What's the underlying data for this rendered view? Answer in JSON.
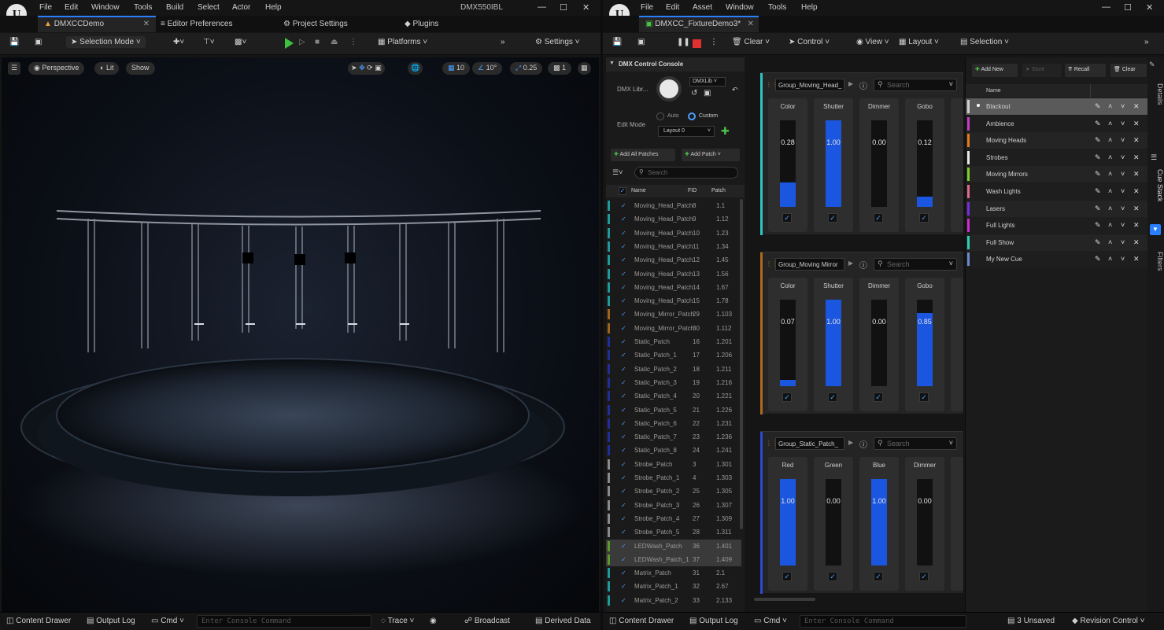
{
  "left": {
    "menu": [
      "File",
      "Edit",
      "Window",
      "Tools",
      "Build",
      "Select",
      "Actor",
      "Help"
    ],
    "title": "DMX550IBL",
    "tabs": {
      "project": "DMXCCDemo",
      "editor_prefs": "Editor Preferences",
      "project_settings": "Project Settings",
      "plugins": "Plugins"
    },
    "toolbar": {
      "selection_mode": "Selection Mode",
      "platforms": "Platforms",
      "settings": "Settings"
    },
    "viewport": {
      "perspective": "Perspective",
      "lit": "Lit",
      "show": "Show",
      "grid": "10",
      "angle": "10°",
      "scale": "0.25",
      "cam": "1"
    },
    "status": {
      "content_drawer": "Content Drawer",
      "output_log": "Output Log",
      "cmd": "Cmd",
      "console_placeholder": "Enter Console Command",
      "trace": "Trace",
      "broadcast": "Broadcast",
      "derived_data": "Derived Data"
    }
  },
  "right": {
    "menu": [
      "File",
      "Edit",
      "Asset",
      "Window",
      "Tools",
      "Help"
    ],
    "tab": "DMXCC_FixtureDemo3*",
    "toolbar": {
      "clear": "Clear",
      "control": "Control",
      "view": "View",
      "layout": "Layout",
      "selection": "Selection"
    },
    "console": {
      "title": "DMX Control Console",
      "dmx_lib_label": "DMX Libr...",
      "dmx_lib_value": "DMXLib",
      "auto": "Auto",
      "custom": "Custom",
      "edit_mode": "Edit Mode",
      "layout": "Layout 0",
      "add_all": "Add All Patches",
      "add_patch": "Add Patch",
      "search": "Search",
      "cols": {
        "name": "Name",
        "fid": "FID",
        "patch": "Patch"
      },
      "patches": [
        {
          "name": "Moving_Head_Patch",
          "fid": "8",
          "patch": "1.1",
          "color": "#1f9a9a"
        },
        {
          "name": "Moving_Head_Patch",
          "fid": "9",
          "patch": "1.12",
          "color": "#1f9a9a"
        },
        {
          "name": "Moving_Head_Patch",
          "fid": "10",
          "patch": "1.23",
          "color": "#1f9a9a"
        },
        {
          "name": "Moving_Head_Patch",
          "fid": "11",
          "patch": "1.34",
          "color": "#1f9a9a"
        },
        {
          "name": "Moving_Head_Patch",
          "fid": "12",
          "patch": "1.45",
          "color": "#1f9a9a"
        },
        {
          "name": "Moving_Head_Patch",
          "fid": "13",
          "patch": "1.56",
          "color": "#1f9a9a"
        },
        {
          "name": "Moving_Head_Patch",
          "fid": "14",
          "patch": "1.67",
          "color": "#1f9a9a"
        },
        {
          "name": "Moving_Head_Patch",
          "fid": "15",
          "patch": "1.78",
          "color": "#1f9a9a"
        },
        {
          "name": "Moving_Mirror_Patch",
          "fid": "29",
          "patch": "1.103",
          "color": "#a0651a"
        },
        {
          "name": "Moving_Mirror_Patch",
          "fid": "30",
          "patch": "1.112",
          "color": "#a0651a"
        },
        {
          "name": "Static_Patch",
          "fid": "16",
          "patch": "1.201",
          "color": "#1e2f9a"
        },
        {
          "name": "Static_Patch_1",
          "fid": "17",
          "patch": "1.206",
          "color": "#1e2f9a"
        },
        {
          "name": "Static_Patch_2",
          "fid": "18",
          "patch": "1.211",
          "color": "#1e2f9a"
        },
        {
          "name": "Static_Patch_3",
          "fid": "19",
          "patch": "1.216",
          "color": "#1e2f9a"
        },
        {
          "name": "Static_Patch_4",
          "fid": "20",
          "patch": "1.221",
          "color": "#1e2f9a"
        },
        {
          "name": "Static_Patch_5",
          "fid": "21",
          "patch": "1.226",
          "color": "#1e2f9a"
        },
        {
          "name": "Static_Patch_6",
          "fid": "22",
          "patch": "1.231",
          "color": "#1e2f9a"
        },
        {
          "name": "Static_Patch_7",
          "fid": "23",
          "patch": "1.236",
          "color": "#1e2f9a"
        },
        {
          "name": "Static_Patch_8",
          "fid": "24",
          "patch": "1.241",
          "color": "#1e2f9a"
        },
        {
          "name": "Strobe_Patch",
          "fid": "3",
          "patch": "1.301",
          "color": "#8a8a8a"
        },
        {
          "name": "Strobe_Patch_1",
          "fid": "4",
          "patch": "1.303",
          "color": "#8a8a8a"
        },
        {
          "name": "Strobe_Patch_2",
          "fid": "25",
          "patch": "1.305",
          "color": "#8a8a8a"
        },
        {
          "name": "Strobe_Patch_3",
          "fid": "26",
          "patch": "1.307",
          "color": "#8a8a8a"
        },
        {
          "name": "Strobe_Patch_4",
          "fid": "27",
          "patch": "1.309",
          "color": "#8a8a8a"
        },
        {
          "name": "Strobe_Patch_5",
          "fid": "28",
          "patch": "1.311",
          "color": "#8a8a8a"
        },
        {
          "name": "LEDWash_Patch",
          "fid": "36",
          "patch": "1.401",
          "color": "#5a9a2a"
        },
        {
          "name": "LEDWash_Patch_1",
          "fid": "37",
          "patch": "1.409",
          "color": "#5a9a2a"
        },
        {
          "name": "Matrix_Patch",
          "fid": "31",
          "patch": "2.1",
          "color": "#1f9a9a"
        },
        {
          "name": "Matrix_Patch_1",
          "fid": "32",
          "patch": "2.67",
          "color": "#1f9a9a"
        },
        {
          "name": "Matrix_Patch_2",
          "fid": "33",
          "patch": "2.133",
          "color": "#1f9a9a"
        }
      ]
    },
    "groups": [
      {
        "name": "Group_Moving_Head_",
        "color": "#2ec4c4",
        "faders": [
          {
            "label": "Color",
            "value": "0.28",
            "level": 0.28
          },
          {
            "label": "Shutter",
            "value": "1.00",
            "level": 1.0
          },
          {
            "label": "Dimmer",
            "value": "0.00",
            "level": 0
          },
          {
            "label": "Gobo",
            "value": "0.12",
            "level": 0.12
          }
        ]
      },
      {
        "name": "Group_Moving Mirror",
        "color": "#b06a1a",
        "faders": [
          {
            "label": "Color",
            "value": "0.07",
            "level": 0.07
          },
          {
            "label": "Shutter",
            "value": "1.00",
            "level": 1.0
          },
          {
            "label": "Dimmer",
            "value": "0.00",
            "level": 0
          },
          {
            "label": "Gobo",
            "value": "0.85",
            "level": 0.85
          }
        ]
      },
      {
        "name": "Group_Static_Patch_",
        "color": "#2a49d6",
        "faders": [
          {
            "label": "Red",
            "value": "1.00",
            "level": 1.0
          },
          {
            "label": "Green",
            "value": "0.00",
            "level": 0
          },
          {
            "label": "Blue",
            "value": "1.00",
            "level": 1.0
          },
          {
            "label": "Dimmer",
            "value": "0.00",
            "level": 0
          }
        ]
      }
    ],
    "group_search": "Search",
    "cue": {
      "add_new": "Add New",
      "store": "Store",
      "recall": "Recall",
      "clear": "Clear",
      "col_name": "Name",
      "items": [
        {
          "name": "Blackout",
          "color": "#cfcfcf"
        },
        {
          "name": "Ambience",
          "color": "#c43cc4"
        },
        {
          "name": "Moving Heads",
          "color": "#e07a1a"
        },
        {
          "name": "Strobes",
          "color": "#e8e8e8"
        },
        {
          "name": "Moving Mirrors",
          "color": "#7ad02a"
        },
        {
          "name": "Wash Lights",
          "color": "#e06a8a"
        },
        {
          "name": "Lasers",
          "color": "#7a2ae0"
        },
        {
          "name": "Full Lights",
          "color": "#d02ad0"
        },
        {
          "name": "Full Show",
          "color": "#2ad0b0"
        },
        {
          "name": "My New Cue",
          "color": "#6a8ad0"
        }
      ],
      "side_tabs": {
        "details": "Details",
        "cue_stack": "Cue Stack",
        "filters": "Filters"
      }
    },
    "status": {
      "content_drawer": "Content Drawer",
      "output_log": "Output Log",
      "cmd": "Cmd",
      "console_placeholder": "Enter Console Command",
      "unsaved": "3 Unsaved",
      "revision": "Revision Control"
    }
  }
}
